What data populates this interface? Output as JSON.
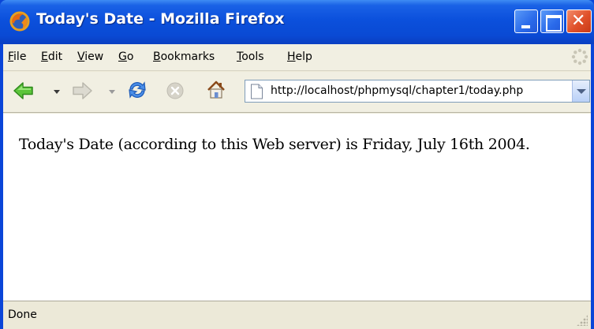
{
  "window": {
    "title": "Today's Date - Mozilla Firefox",
    "app_icon": "firefox-icon",
    "controls": {
      "minimize": "minimize-icon",
      "maximize": "maximize-icon",
      "close_glyph": "✕"
    }
  },
  "menubar": {
    "items": [
      {
        "label": "File",
        "mnemonic": "F"
      },
      {
        "label": "Edit",
        "mnemonic": "E"
      },
      {
        "label": "View",
        "mnemonic": "V"
      },
      {
        "label": "Go",
        "mnemonic": "G"
      },
      {
        "label": "Bookmarks",
        "mnemonic": "B"
      },
      {
        "label": "Tools",
        "mnemonic": "T"
      },
      {
        "label": "Help",
        "mnemonic": "H"
      }
    ]
  },
  "toolbar": {
    "buttons": [
      {
        "name": "back",
        "icon": "back-arrow-icon",
        "enabled": true
      },
      {
        "name": "forward",
        "icon": "forward-arrow-icon",
        "enabled": false
      },
      {
        "name": "reload",
        "icon": "reload-icon",
        "enabled": true
      },
      {
        "name": "stop",
        "icon": "stop-icon",
        "enabled": false
      },
      {
        "name": "home",
        "icon": "home-icon",
        "enabled": true
      }
    ],
    "address": {
      "value": "http://localhost/phpmysql/chapter1/today.php",
      "page_icon": "page-icon"
    }
  },
  "content": {
    "text": "Today's Date (according to this Web server) is Friday, July 16th 2004."
  },
  "statusbar": {
    "text": "Done"
  },
  "colors": {
    "titlebar": "#0a4ad4",
    "chrome": "#ece9d8",
    "close_button": "#e0502a"
  }
}
